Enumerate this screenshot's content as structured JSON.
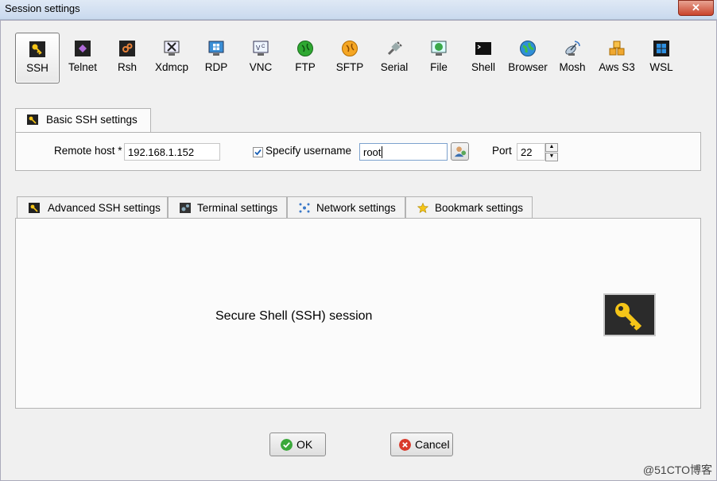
{
  "window": {
    "title": "Session settings",
    "close_label": "✕"
  },
  "session_types": [
    {
      "label": "SSH"
    },
    {
      "label": "Telnet"
    },
    {
      "label": "Rsh"
    },
    {
      "label": "Xdmcp"
    },
    {
      "label": "RDP"
    },
    {
      "label": "VNC"
    },
    {
      "label": "FTP"
    },
    {
      "label": "SFTP"
    },
    {
      "label": "Serial"
    },
    {
      "label": "File"
    },
    {
      "label": "Shell"
    },
    {
      "label": "Browser"
    },
    {
      "label": "Mosh"
    },
    {
      "label": "Aws S3"
    },
    {
      "label": "WSL"
    }
  ],
  "selected_session": "SSH",
  "basic": {
    "tab_label": "Basic SSH settings",
    "remote_host_label": "Remote host *",
    "remote_host_value": "192.168.1.152",
    "specify_username_label": "Specify username",
    "specify_username_checked": true,
    "username_value": "root",
    "port_label": "Port",
    "port_value": "22"
  },
  "tabs": [
    {
      "label": "Advanced SSH settings"
    },
    {
      "label": "Terminal settings"
    },
    {
      "label": "Network settings"
    },
    {
      "label": "Bookmark settings"
    }
  ],
  "panel": {
    "description": "Secure Shell (SSH) session"
  },
  "buttons": {
    "ok_label": "OK",
    "cancel_label": "Cancel"
  },
  "watermark": "@51CTO博客",
  "colors": {
    "key_yellow": "#f5c518",
    "ok_green": "#3aa83a",
    "cancel_red": "#d93a2b"
  }
}
